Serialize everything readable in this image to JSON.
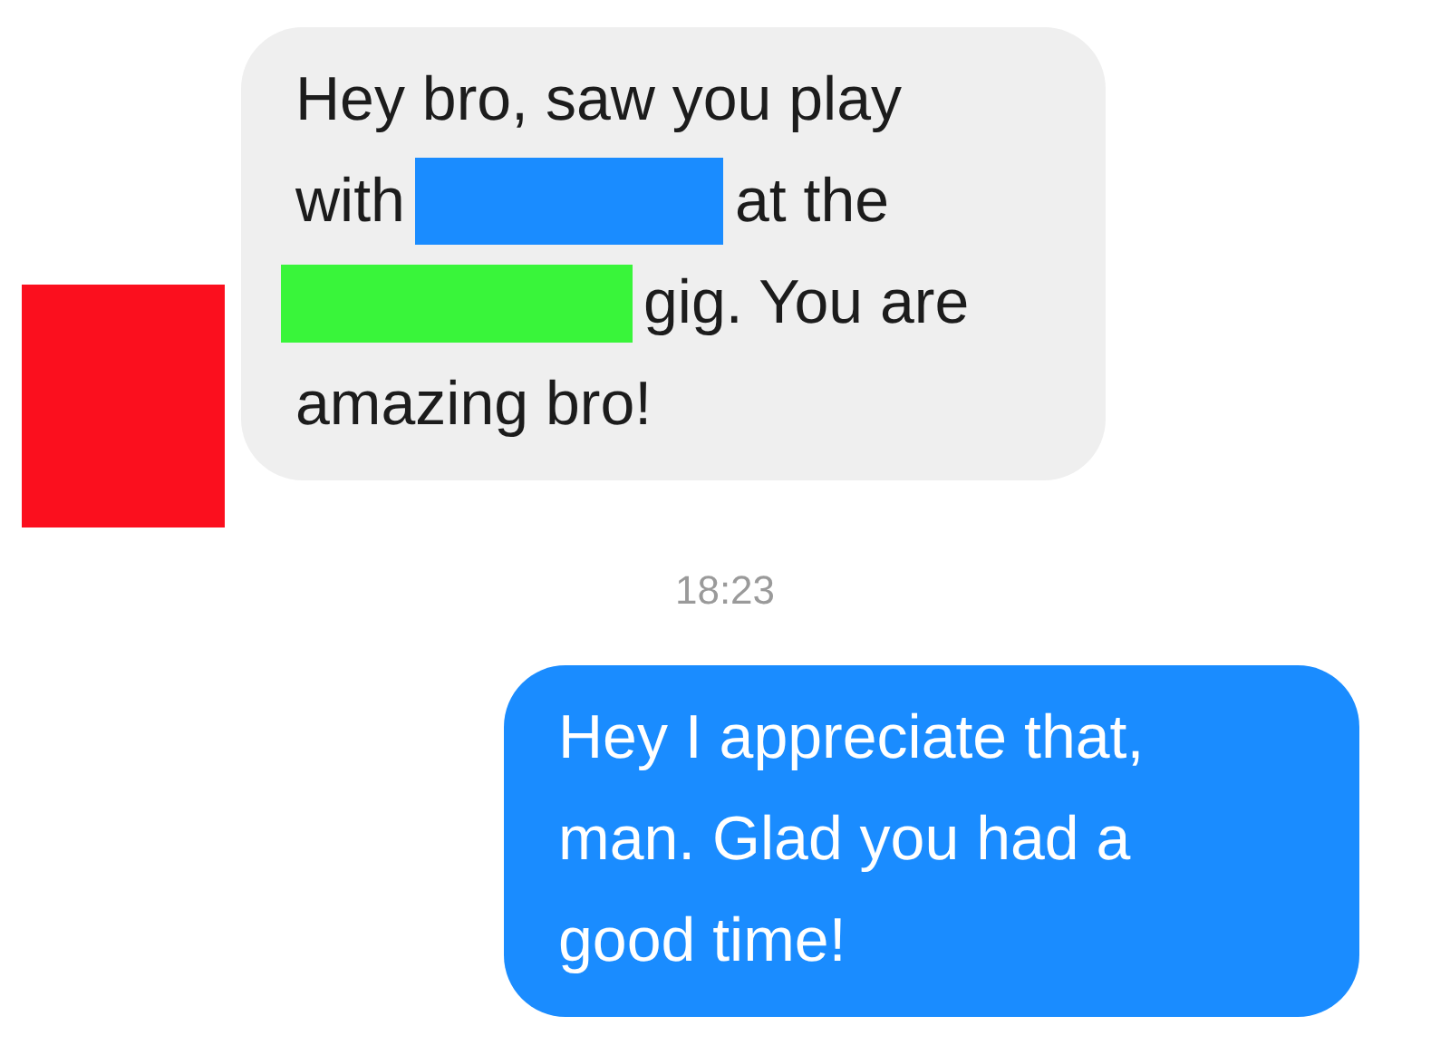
{
  "messages": [
    {
      "kind": "incoming",
      "avatar": {
        "color": "#fb0f1e"
      },
      "lines": [
        [
          {
            "kind": "text",
            "text": "Hey bro, saw you play"
          }
        ],
        [
          {
            "kind": "text",
            "text": "with"
          },
          {
            "kind": "redaction",
            "color": "#1a8cff"
          },
          {
            "kind": "text",
            "text": "at the"
          }
        ],
        [
          {
            "kind": "redaction",
            "color": "#39f53a"
          },
          {
            "kind": "text",
            "text": "gig. You are"
          }
        ],
        [
          {
            "kind": "text",
            "text": "amazing bro!"
          }
        ]
      ]
    },
    {
      "kind": "time",
      "text": "18:23"
    },
    {
      "kind": "outgoing",
      "lines": [
        [
          {
            "kind": "text",
            "text": "Hey I appreciate that,"
          }
        ],
        [
          {
            "kind": "text",
            "text": "man. Glad you had a"
          }
        ],
        [
          {
            "kind": "text",
            "text": "good time!"
          }
        ]
      ]
    }
  ]
}
